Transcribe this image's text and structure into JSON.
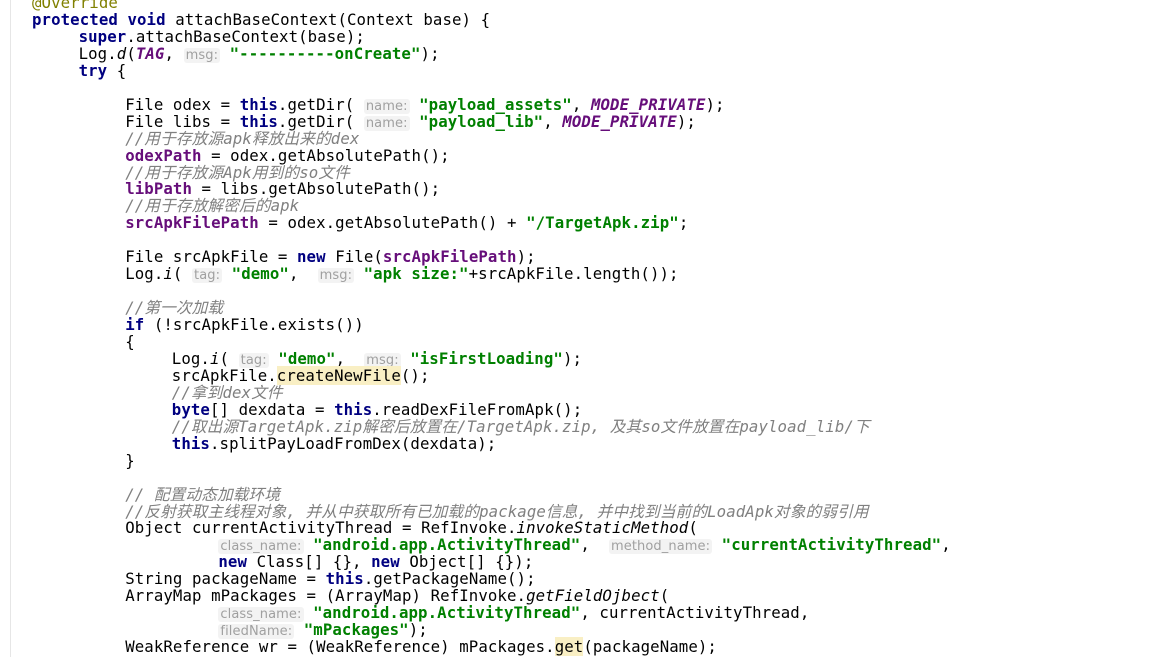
{
  "editor": {
    "lines": [
      {
        "indent": 0,
        "tokens": [
          {
            "t": "@Override",
            "c": "ann"
          }
        ]
      },
      {
        "indent": 0,
        "tokens": [
          {
            "t": "protected ",
            "c": "kw"
          },
          {
            "t": "void ",
            "c": "kw"
          },
          {
            "t": "attachBaseContext(Context base) {"
          }
        ]
      },
      {
        "indent": 1,
        "tokens": [
          {
            "t": "super",
            "c": "kw"
          },
          {
            "t": ".attachBaseContext(base);"
          }
        ]
      },
      {
        "indent": 1,
        "tokens": [
          {
            "t": "Log."
          },
          {
            "t": "d",
            "c": "static"
          },
          {
            "t": "("
          },
          {
            "t": "TAG",
            "c": "const"
          },
          {
            "t": ", "
          },
          {
            "t": "msg:",
            "c": "hint"
          },
          {
            "t": " "
          },
          {
            "t": "\"----------onCreate\"",
            "c": "str"
          },
          {
            "t": ");"
          }
        ]
      },
      {
        "indent": 1,
        "tokens": [
          {
            "t": "try ",
            "c": "kw"
          },
          {
            "t": "{"
          }
        ]
      },
      {
        "indent": 0,
        "tokens": []
      },
      {
        "indent": 2,
        "tokens": [
          {
            "t": "File odex = "
          },
          {
            "t": "this",
            "c": "kw"
          },
          {
            "t": ".getDir( "
          },
          {
            "t": "name:",
            "c": "hint"
          },
          {
            "t": " "
          },
          {
            "t": "\"payload_assets\"",
            "c": "str"
          },
          {
            "t": ", "
          },
          {
            "t": "MODE_PRIVATE",
            "c": "const"
          },
          {
            "t": ");"
          }
        ]
      },
      {
        "indent": 2,
        "tokens": [
          {
            "t": "File libs = "
          },
          {
            "t": "this",
            "c": "kw"
          },
          {
            "t": ".getDir( "
          },
          {
            "t": "name:",
            "c": "hint"
          },
          {
            "t": " "
          },
          {
            "t": "\"payload_lib\"",
            "c": "str"
          },
          {
            "t": ", "
          },
          {
            "t": "MODE_PRIVATE",
            "c": "const"
          },
          {
            "t": ");"
          }
        ]
      },
      {
        "indent": 2,
        "tokens": [
          {
            "t": "//用于存放源apk释放出来的dex",
            "c": "cmt"
          }
        ]
      },
      {
        "indent": 2,
        "tokens": [
          {
            "t": "odexPath",
            "c": "fld"
          },
          {
            "t": " = odex.getAbsolutePath();"
          }
        ]
      },
      {
        "indent": 2,
        "tokens": [
          {
            "t": "//用于存放源Apk用到的so文件",
            "c": "cmt"
          }
        ]
      },
      {
        "indent": 2,
        "tokens": [
          {
            "t": "libPath",
            "c": "fld"
          },
          {
            "t": " = libs.getAbsolutePath();"
          }
        ]
      },
      {
        "indent": 2,
        "tokens": [
          {
            "t": "//用于存放解密后的apk",
            "c": "cmt"
          }
        ]
      },
      {
        "indent": 2,
        "tokens": [
          {
            "t": "srcApkFilePath",
            "c": "fld"
          },
          {
            "t": " = odex.getAbsolutePath() + "
          },
          {
            "t": "\"/TargetApk.zip\"",
            "c": "str"
          },
          {
            "t": ";"
          }
        ]
      },
      {
        "indent": 0,
        "tokens": []
      },
      {
        "indent": 2,
        "tokens": [
          {
            "t": "File srcApkFile = "
          },
          {
            "t": "new ",
            "c": "kw"
          },
          {
            "t": "File("
          },
          {
            "t": "srcApkFilePath",
            "c": "fld"
          },
          {
            "t": ");"
          }
        ]
      },
      {
        "indent": 2,
        "tokens": [
          {
            "t": "Log."
          },
          {
            "t": "i",
            "c": "static"
          },
          {
            "t": "( "
          },
          {
            "t": "tag:",
            "c": "hint"
          },
          {
            "t": " "
          },
          {
            "t": "\"demo\"",
            "c": "str"
          },
          {
            "t": ",  "
          },
          {
            "t": "msg:",
            "c": "hint"
          },
          {
            "t": " "
          },
          {
            "t": "\"apk size:\"",
            "c": "str"
          },
          {
            "t": "+srcApkFile.length());"
          }
        ]
      },
      {
        "indent": 0,
        "tokens": []
      },
      {
        "indent": 2,
        "tokens": [
          {
            "t": "//第一次加载",
            "c": "cmt"
          }
        ]
      },
      {
        "indent": 2,
        "tokens": [
          {
            "t": "if ",
            "c": "kw"
          },
          {
            "t": "(!srcApkFile.exists())"
          }
        ]
      },
      {
        "indent": 2,
        "tokens": [
          {
            "t": "{"
          }
        ]
      },
      {
        "indent": 3,
        "tokens": [
          {
            "t": "Log."
          },
          {
            "t": "i",
            "c": "static"
          },
          {
            "t": "( "
          },
          {
            "t": "tag:",
            "c": "hint"
          },
          {
            "t": " "
          },
          {
            "t": "\"demo\"",
            "c": "str"
          },
          {
            "t": ",  "
          },
          {
            "t": "msg:",
            "c": "hint"
          },
          {
            "t": " "
          },
          {
            "t": "\"isFirstLoading\"",
            "c": "str"
          },
          {
            "t": ");"
          }
        ]
      },
      {
        "indent": 3,
        "tokens": [
          {
            "t": "srcApkFile."
          },
          {
            "t": "createNewFile",
            "c": "hl"
          },
          {
            "t": "();"
          }
        ]
      },
      {
        "indent": 3,
        "tokens": [
          {
            "t": "//拿到dex文件",
            "c": "cmt"
          }
        ]
      },
      {
        "indent": 3,
        "tokens": [
          {
            "t": "byte",
            "c": "kw"
          },
          {
            "t": "[] dexdata = "
          },
          {
            "t": "this",
            "c": "kw"
          },
          {
            "t": ".readDexFileFromApk();"
          }
        ]
      },
      {
        "indent": 3,
        "tokens": [
          {
            "t": "//取出源TargetApk.zip解密后放置在/TargetApk.zip, 及其so文件放置在payload_lib/下",
            "c": "cmt"
          }
        ]
      },
      {
        "indent": 3,
        "tokens": [
          {
            "t": "this",
            "c": "kw"
          },
          {
            "t": ".splitPayLoadFromDex(dexdata);"
          }
        ]
      },
      {
        "indent": 2,
        "tokens": [
          {
            "t": "}"
          }
        ]
      },
      {
        "indent": 0,
        "tokens": []
      },
      {
        "indent": 2,
        "tokens": [
          {
            "t": "// 配置动态加载环境",
            "c": "cmt"
          }
        ]
      },
      {
        "indent": 2,
        "tokens": [
          {
            "t": "//反射获取主线程对象, 并从中获取所有已加载的package信息, 并中找到当前的LoadApk对象的弱引用",
            "c": "cmt"
          }
        ]
      },
      {
        "indent": 2,
        "tokens": [
          {
            "t": "Object currentActivityThread = RefInvoke."
          },
          {
            "t": "invokeStaticMethod",
            "c": "static"
          },
          {
            "t": "("
          }
        ]
      },
      {
        "indent": 4,
        "tokens": [
          {
            "t": "class_name:",
            "c": "hint"
          },
          {
            "t": " "
          },
          {
            "t": "\"android.app.ActivityThread\"",
            "c": "str"
          },
          {
            "t": ",  "
          },
          {
            "t": "method_name:",
            "c": "hint"
          },
          {
            "t": " "
          },
          {
            "t": "\"currentActivityThread\"",
            "c": "str"
          },
          {
            "t": ","
          }
        ]
      },
      {
        "indent": 4,
        "tokens": [
          {
            "t": "new ",
            "c": "kw"
          },
          {
            "t": "Class[] {}, "
          },
          {
            "t": "new ",
            "c": "kw"
          },
          {
            "t": "Object[] {});"
          }
        ]
      },
      {
        "indent": 2,
        "tokens": [
          {
            "t": "String packageName = "
          },
          {
            "t": "this",
            "c": "kw"
          },
          {
            "t": ".getPackageName();"
          }
        ]
      },
      {
        "indent": 2,
        "tokens": [
          {
            "t": "ArrayMap mPackages = (ArrayMap) RefInvoke."
          },
          {
            "t": "getFieldOjbect",
            "c": "static"
          },
          {
            "t": "("
          }
        ]
      },
      {
        "indent": 4,
        "tokens": [
          {
            "t": "class_name:",
            "c": "hint"
          },
          {
            "t": " "
          },
          {
            "t": "\"android.app.ActivityThread\"",
            "c": "str"
          },
          {
            "t": ", currentActivityThread,"
          }
        ]
      },
      {
        "indent": 4,
        "tokens": [
          {
            "t": "filedName:",
            "c": "hint"
          },
          {
            "t": " "
          },
          {
            "t": "\"mPackages\"",
            "c": "str"
          },
          {
            "t": ");"
          }
        ]
      },
      {
        "indent": 2,
        "tokens": [
          {
            "t": "WeakReference wr = (WeakReference) mPackages."
          },
          {
            "t": "get",
            "c": "hl"
          },
          {
            "t": "(packageName);"
          }
        ]
      }
    ]
  }
}
